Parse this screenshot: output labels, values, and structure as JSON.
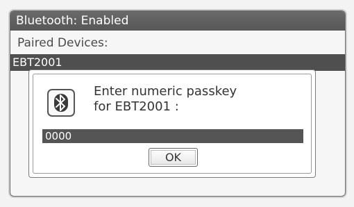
{
  "window": {
    "title": "Bluetooth: Enabled"
  },
  "paired": {
    "label": "Paired Devices:",
    "selected_device": "EBT2001"
  },
  "dialog": {
    "icon": "bluetooth-icon",
    "message_line1": "Enter numeric passkey",
    "message_line2": "for EBT2001 :",
    "passkey_value": "0000",
    "ok_label": "OK"
  }
}
